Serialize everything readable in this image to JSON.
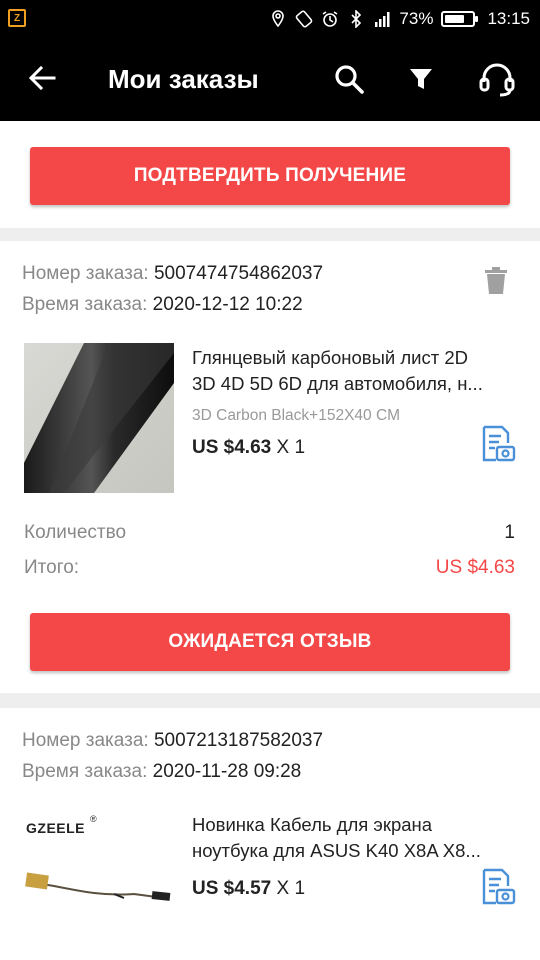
{
  "status_bar": {
    "battery_percent": "73%",
    "battery_level": 0.73,
    "time": "13:15"
  },
  "app_bar": {
    "title": "Мои заказы",
    "icons": [
      "back-arrow-icon",
      "search-icon",
      "filter-icon",
      "support-headset-icon"
    ]
  },
  "top_action": {
    "confirm_label": "ПОДТВЕРДИТЬ ПОЛУЧЕНИЕ"
  },
  "orders": [
    {
      "number_label": "Номер заказа:",
      "number": "5007474754862037",
      "time_label": "Время заказа:",
      "time": "2020-12-12 10:22",
      "product": {
        "name_line1": "Глянцевый карбоновый лист 2D",
        "name_line2": "3D 4D 5D 6D для автомобиля, н...",
        "variant": "3D Carbon Black+152X40 CM",
        "price": "US $4.63",
        "qty_text": "X 1"
      },
      "quantity_label": "Количество",
      "quantity_value": "1",
      "total_label": "Итого:",
      "total_value": "US $4.63",
      "action_label": "ОЖИДАЕТСЯ ОТЗЫВ"
    },
    {
      "number_label": "Номер заказа:",
      "number": "5007213187582037",
      "time_label": "Время заказа:",
      "time": "2020-11-28 09:28",
      "product": {
        "brand": "GZEELE",
        "name_line1": "Новинка Кабель для экрана",
        "name_line2": "ноутбука для ASUS K40 X8A X8...",
        "price": "US $4.57",
        "qty_text": "X 1"
      }
    }
  ],
  "colors": {
    "accent_red": "#f44848",
    "icon_blue": "#4a90d9",
    "bar_black": "#000000"
  }
}
